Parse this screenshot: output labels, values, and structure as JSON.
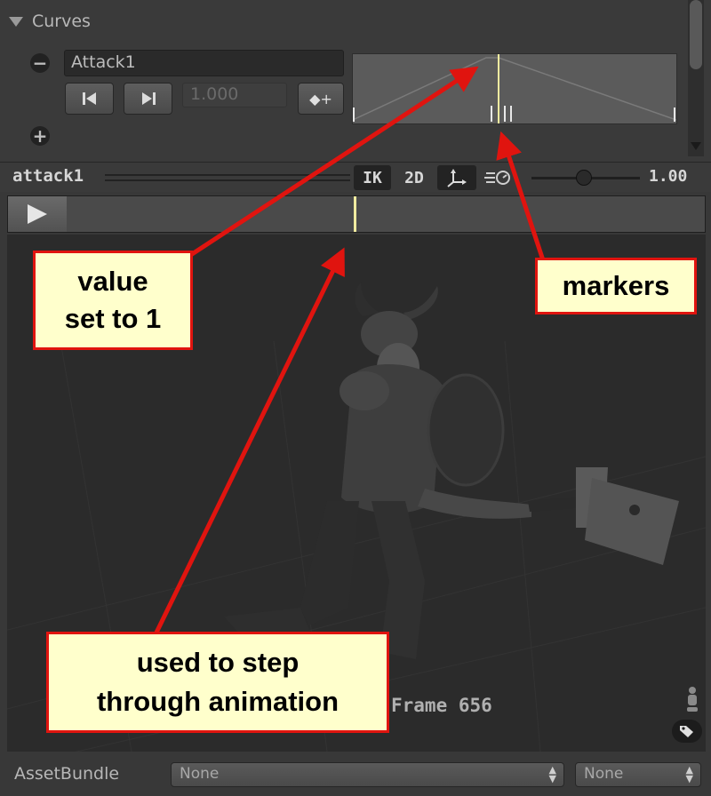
{
  "curves": {
    "header": "Curves",
    "curve_name": "Attack1",
    "value": "1.000",
    "key_button": "◆+"
  },
  "preview": {
    "clip_name": "attack1",
    "ik": "IK",
    "mode_2d": "2D",
    "speed": "1.00"
  },
  "viewport": {
    "frame_label": "Frame 656"
  },
  "assetbundle": {
    "label": "AssetBundle",
    "bundle_value": "None",
    "variant_value": "None"
  },
  "annotations": {
    "value_callout": [
      "value",
      "set to 1"
    ],
    "markers_callout": "markers",
    "step_callout": [
      "used to step",
      "through animation"
    ],
    "arrow_color": "#e0140f",
    "callout_bg": "#ffffcc"
  }
}
